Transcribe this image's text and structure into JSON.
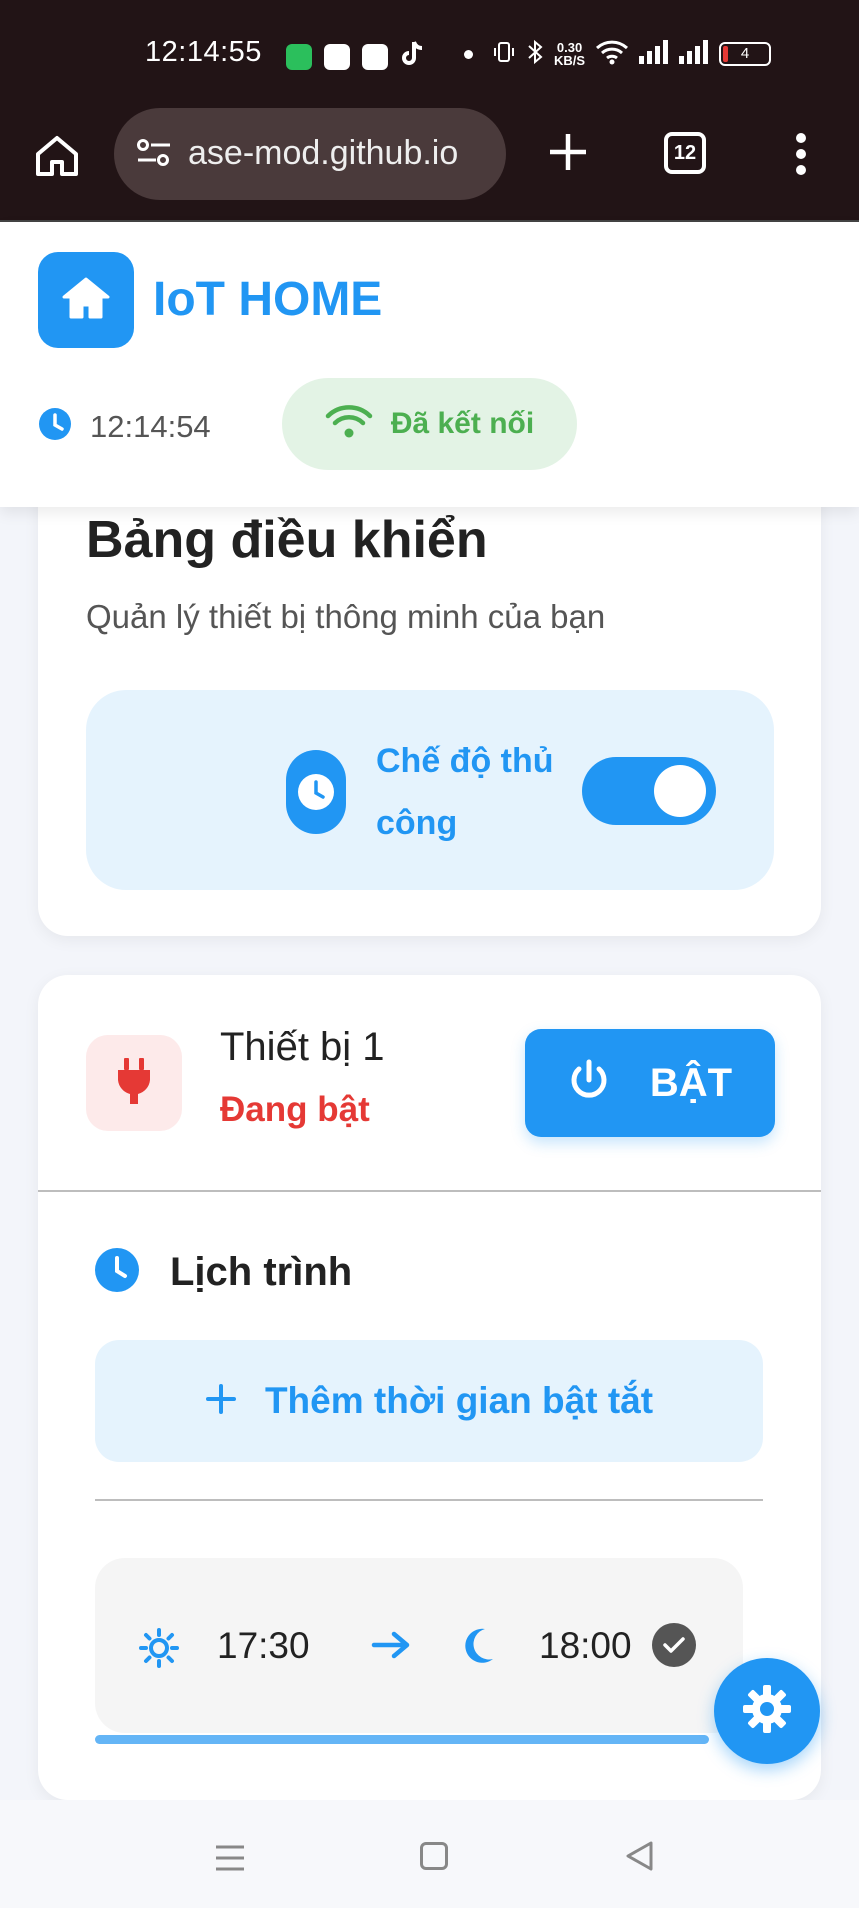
{
  "status_bar": {
    "time": "12:14:55",
    "net_speed_value": "0.30",
    "net_speed_unit": "KB/S",
    "battery": "4"
  },
  "browser": {
    "url": "ase-mod.github.io",
    "tab_count": "12"
  },
  "header": {
    "app_title": "IoT HOME",
    "clock": "12:14:54",
    "connection_status": "Đã kết nối"
  },
  "dashboard": {
    "title": "Bảng điều khiển",
    "subtitle": "Quản lý thiết bị thông minh của bạn",
    "mode_label": "Chế độ thủ công",
    "mode_enabled": true
  },
  "device": {
    "name": "Thiết bị 1",
    "status": "Đang bật",
    "power_button_label": "BẬT",
    "schedule_title": "Lịch trình",
    "add_schedule_label": "Thêm thời gian bật tắt",
    "schedules": [
      {
        "on_time": "17:30",
        "off_time": "18:00",
        "active": true
      }
    ]
  },
  "colors": {
    "primary": "#2196f3",
    "success": "#4caf50",
    "danger": "#e53935",
    "browser_bar": "#221416"
  },
  "icons": {
    "header_logo": "home-icon",
    "fab": "gear-icon"
  }
}
